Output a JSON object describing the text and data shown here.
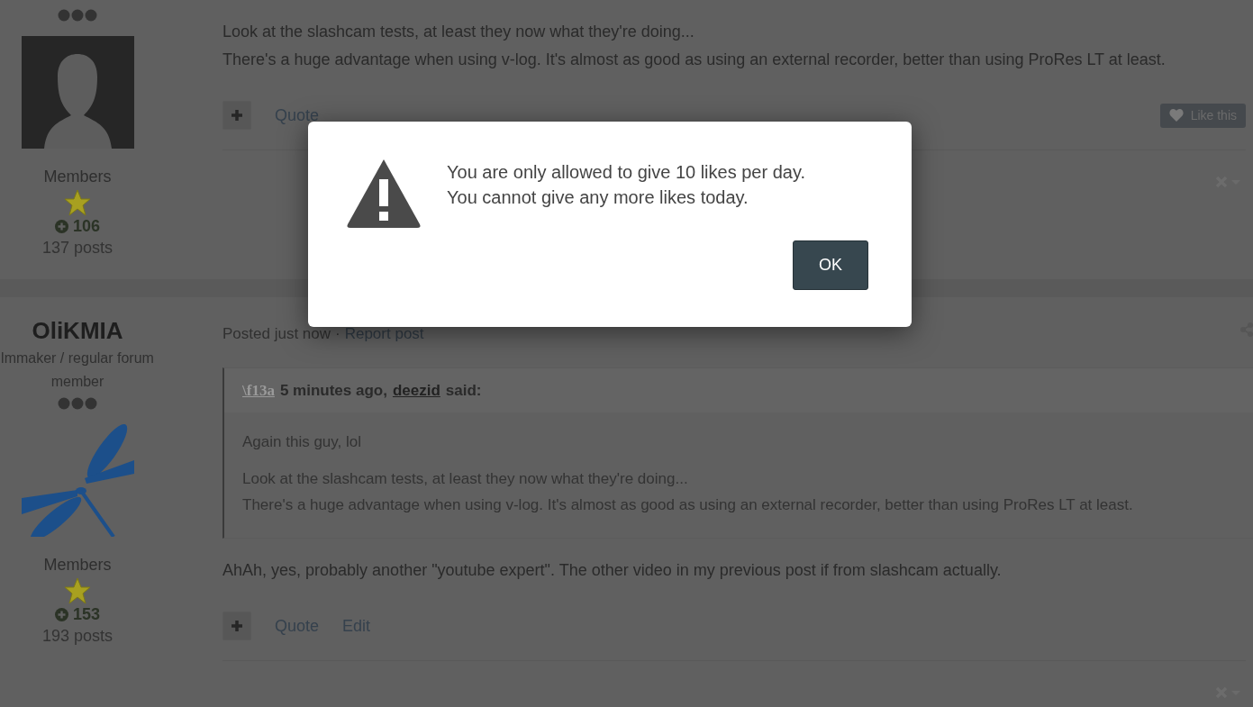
{
  "posts": [
    {
      "author": {
        "group": "Members",
        "reputation": "106",
        "post_count": "137 posts",
        "avatar": {
          "kind": "silhouette"
        }
      },
      "paragraphs": [
        "Look at the slashcam tests, at least they now what they're doing...\nThere's a huge advantage when using v-log. It's almost as good as using an external recorder, better than using ProRes LT at least."
      ],
      "actions": [
        "Quote"
      ],
      "like_button": "Like this"
    },
    {
      "author": {
        "name": "OliKMIA",
        "title": "lmmaker / regular forum member",
        "group": "Members",
        "reputation": "153",
        "post_count": "193 posts",
        "avatar": {
          "kind": "dragonfly"
        }
      },
      "meta": {
        "posted": "Posted just now",
        "separator": "·",
        "report": "Report post"
      },
      "quote": {
        "icon_text": "\\f13a",
        "time": "5 minutes ago,",
        "user": "deezid",
        "said": "said:",
        "paragraphs": [
          "Again this guy, lol",
          "Look at the slashcam tests, at least they now what they're doing...\nThere's a huge advantage when using v-log. It's almost as good as using an external recorder, better than using ProRes LT at least."
        ]
      },
      "paragraphs": [
        "AhAh, yes, probably another \"youtube expert\". The other video in my previous post if from slashcam actually."
      ],
      "actions": [
        "Quote",
        "Edit"
      ]
    }
  ],
  "dialog": {
    "message_lines": [
      "You are only allowed to give 10 likes per day.",
      "You cannot give any more likes today."
    ],
    "button": "OK"
  }
}
